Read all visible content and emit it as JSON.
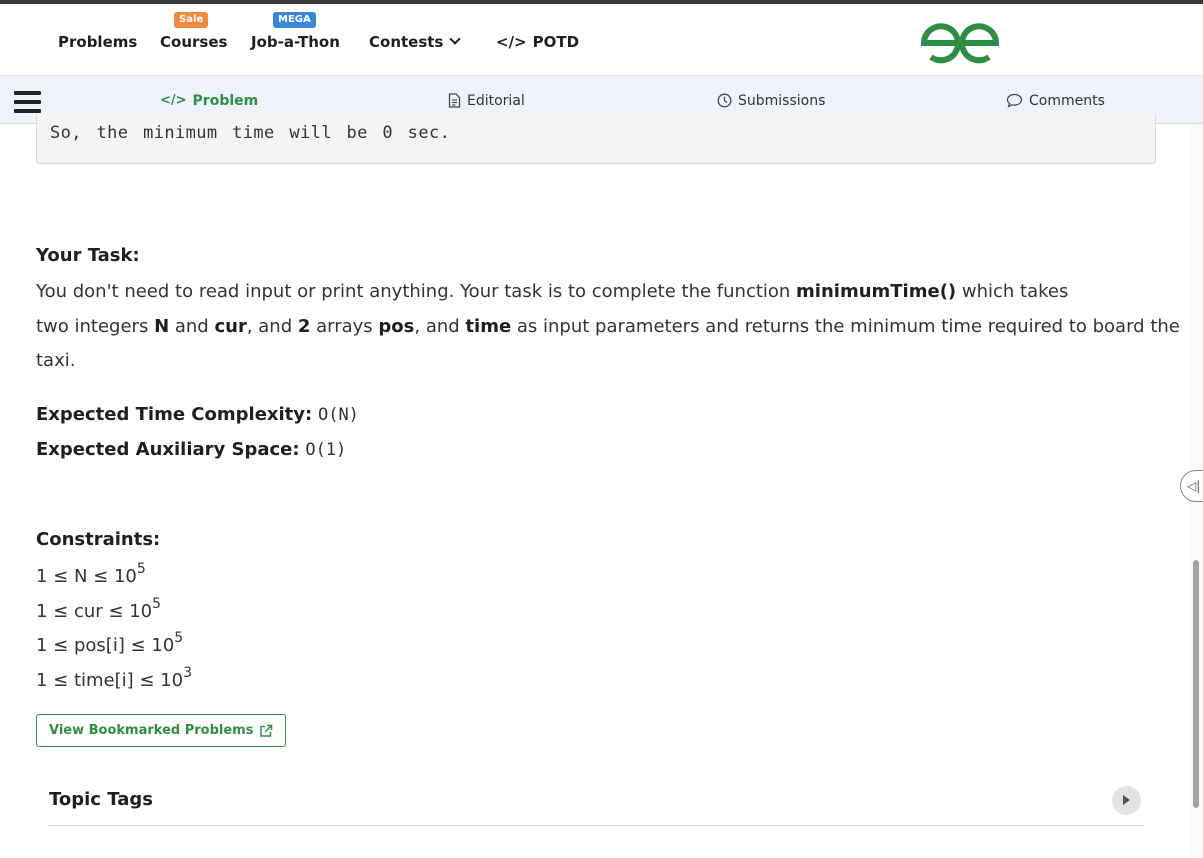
{
  "nav": {
    "items": {
      "problems": "Problems",
      "courses": "Courses",
      "jobathon": "Job-a-Thon",
      "contests": "Contests",
      "potd": "POTD"
    },
    "badges": {
      "sale": "Sale",
      "mega": "MEGA"
    },
    "potd_icon": "</>",
    "logo_icon": "gfg-logo-icon"
  },
  "tabs": [
    {
      "label": "Problem",
      "icon": "</>",
      "active": true
    },
    {
      "label": "Editorial",
      "icon": "document-icon"
    },
    {
      "label": "Submissions",
      "icon": "clock-icon"
    },
    {
      "label": "Comments",
      "icon": "comment-icon"
    }
  ],
  "example_tail": "So, the minimum time will be 0 sec.",
  "task": {
    "heading": "Your Task:",
    "p1": "You don't need to read input or print anything. Your task is to complete the function ",
    "fn": "minimumTime()",
    "p2": " which takes",
    "p3": "two integers ",
    "n": "N",
    "p4": " and ",
    "cur": "cur",
    "p5": ", and ",
    "two": "2",
    "p6": " arrays ",
    "pos": "pos",
    "p7": ", and ",
    "time": "time",
    "p8": " as input parameters and returns the minimum time required to board the",
    "p9": "taxi."
  },
  "complexity": {
    "time_label": "Expected Time Complexity:",
    "time_value": "O(N)",
    "space_label": "Expected Auxiliary Space:",
    "space_value": "O(1)"
  },
  "constraints": {
    "heading": "Constraints:",
    "lines": [
      {
        "text": "1 ≤ N ≤ 10",
        "exp": "5"
      },
      {
        "text": "1 ≤ cur ≤ 10",
        "exp": "5"
      },
      {
        "text": "1 ≤ pos[i] ≤ 10",
        "exp": "5"
      },
      {
        "text": "1 ≤ time[i] ≤ 10",
        "exp": "3"
      }
    ]
  },
  "bookmark_button": "View Bookmarked Problems",
  "topic_tags": "Topic Tags",
  "colors": {
    "brand_green": "#2f8d46",
    "sale": "#f08a3c",
    "mega": "#3a86d8"
  }
}
